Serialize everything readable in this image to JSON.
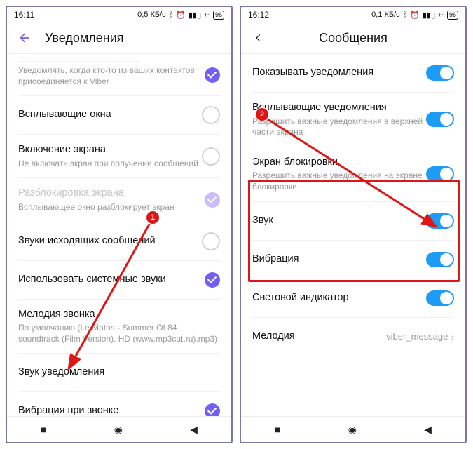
{
  "left": {
    "status": {
      "time": "16:11",
      "speed": "0,5 КБ/с",
      "battery": "96"
    },
    "title": "Уведомления",
    "rows": {
      "contactJoined": {
        "sub": "Уведомлять, когда кто-то из ваших контактов присоединяется к Viber"
      },
      "popup": {
        "main": "Всплывающие окна"
      },
      "screenOn": {
        "main": "Включение экрана",
        "sub": "Не включать экран при получении сообщений"
      },
      "unlock": {
        "main": "Разблокировка экрана",
        "sub": "Всплывающее окно разблокирует экран"
      },
      "outgoing": {
        "main": "Звуки исходящих сообщений"
      },
      "systemSounds": {
        "main": "Использовать системные звуки"
      },
      "ringtone": {
        "main": "Мелодия звонка",
        "sub": "По умолчанию (Le Matos - Summer Of 84 soundtrack (Film Version). HD (www.mp3cut.ru).mp3)"
      },
      "notifSound": {
        "main": "Звук уведомления"
      },
      "vibrateCall": {
        "main": "Вибрация при звонке"
      }
    }
  },
  "right": {
    "status": {
      "time": "16:12",
      "speed": "0,1 КБ/с",
      "battery": "96"
    },
    "title": "Сообщения",
    "rows": {
      "show": {
        "main": "Показывать уведомления"
      },
      "floating": {
        "main": "Всплывающие уведомления",
        "sub": "Разрешить важные уведомления в верхней части экрана"
      },
      "lock": {
        "main": "Экран блокировки",
        "sub": "Разрешить важные уведомления на экране блокировки"
      },
      "sound": {
        "main": "Звук"
      },
      "vibrate": {
        "main": "Вибрация"
      },
      "led": {
        "main": "Световой индикатор"
      },
      "melody": {
        "main": "Мелодия",
        "value": "viber_message"
      }
    }
  },
  "annotations": {
    "badge1": "1",
    "badge2": "2"
  }
}
